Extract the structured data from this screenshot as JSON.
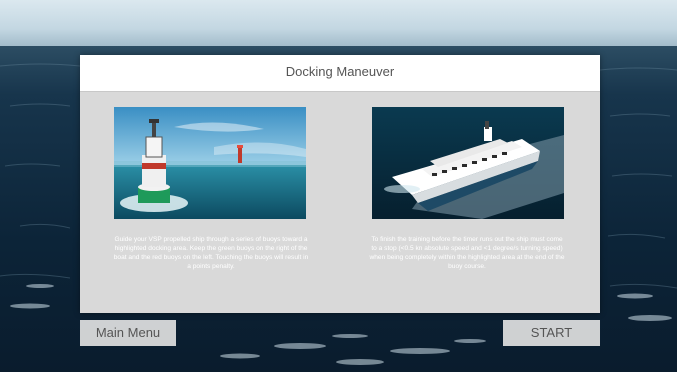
{
  "dialog": {
    "title": "Docking Maneuver",
    "left_description": "Guide your VSP propelled ship through a series of buoys toward a highlighted docking area. Keep the green buoys on the right of the boat and the red buoys on the left. Touching the buoys will result in a points penalty.",
    "right_description": "To finish the training before the timer runs out the ship must come to a stop (<0.5 kn absolute speed and <1 degree/s turning speed) when being completely within the highlighted area at the end of the buoy course."
  },
  "buttons": {
    "main_menu": "Main Menu",
    "start": "START"
  },
  "images": {
    "left": "buoy-scene-image",
    "right": "ferry-docking-image"
  },
  "colors": {
    "panel_bg": "#d9d9d9",
    "header_bg": "#ffffff",
    "title_text": "#555555",
    "sea_dark": "#0b1f31"
  }
}
